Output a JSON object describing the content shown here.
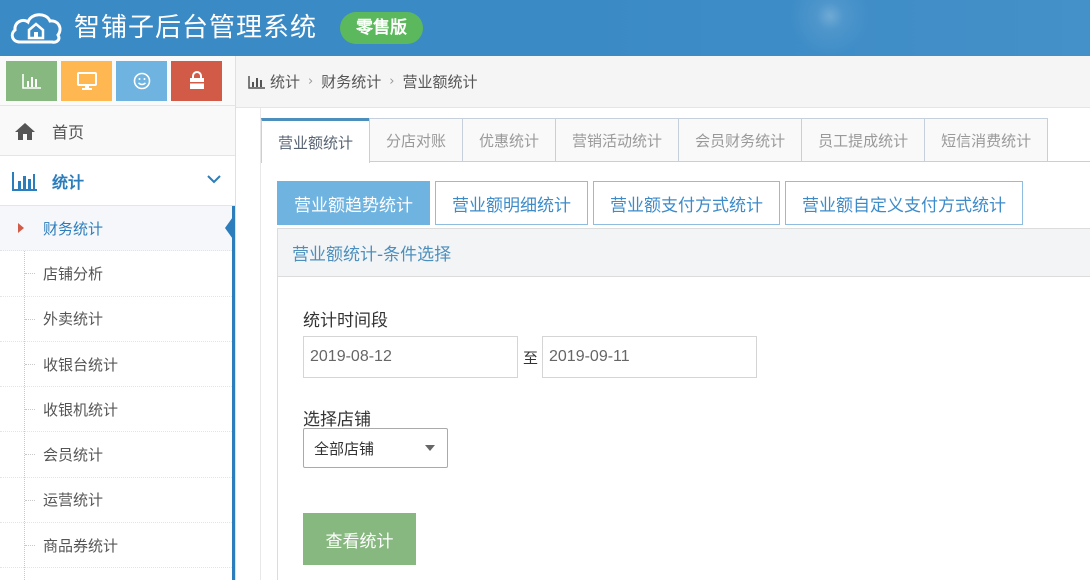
{
  "header": {
    "title": "智铺子后台管理系统",
    "edition_badge": "零售版",
    "logo_icon": "cloud-home-icon",
    "bg_color": "#3a8ac6"
  },
  "sidebar": {
    "quick_buttons": [
      {
        "icon": "bar-chart-icon",
        "color": "#87b87f"
      },
      {
        "icon": "monitor-icon",
        "color": "#ffb752"
      },
      {
        "icon": "smiley-icon",
        "color": "#6fb3e0"
      },
      {
        "icon": "shopping-bag-icon",
        "color": "#d15b47"
      }
    ],
    "home_label": "首页",
    "stats_label": "统计",
    "sub_items": [
      {
        "label": "财务统计",
        "active": true
      },
      {
        "label": "店铺分析"
      },
      {
        "label": "外卖统计"
      },
      {
        "label": "收银台统计"
      },
      {
        "label": "收银机统计"
      },
      {
        "label": "会员统计"
      },
      {
        "label": "运营统计"
      },
      {
        "label": "商品券统计"
      }
    ]
  },
  "breadcrumb": [
    "统计",
    "财务统计",
    "营业额统计"
  ],
  "tabs": [
    "营业额统计",
    "分店对账",
    "优惠统计",
    "营销活动统计",
    "会员财务统计",
    "员工提成统计",
    "短信消费统计"
  ],
  "subtabs": [
    "营业额趋势统计",
    "营业额明细统计",
    "营业额支付方式统计",
    "营业额自定义支付方式统计"
  ],
  "panel": {
    "title": "营业额统计-条件选择",
    "period_label": "统计时间段",
    "date_from": "2019-08-12",
    "date_to": "2019-09-11",
    "range_sep": "至",
    "store_label": "选择店铺",
    "store_value": "全部店铺",
    "submit_label": "查看统计"
  }
}
